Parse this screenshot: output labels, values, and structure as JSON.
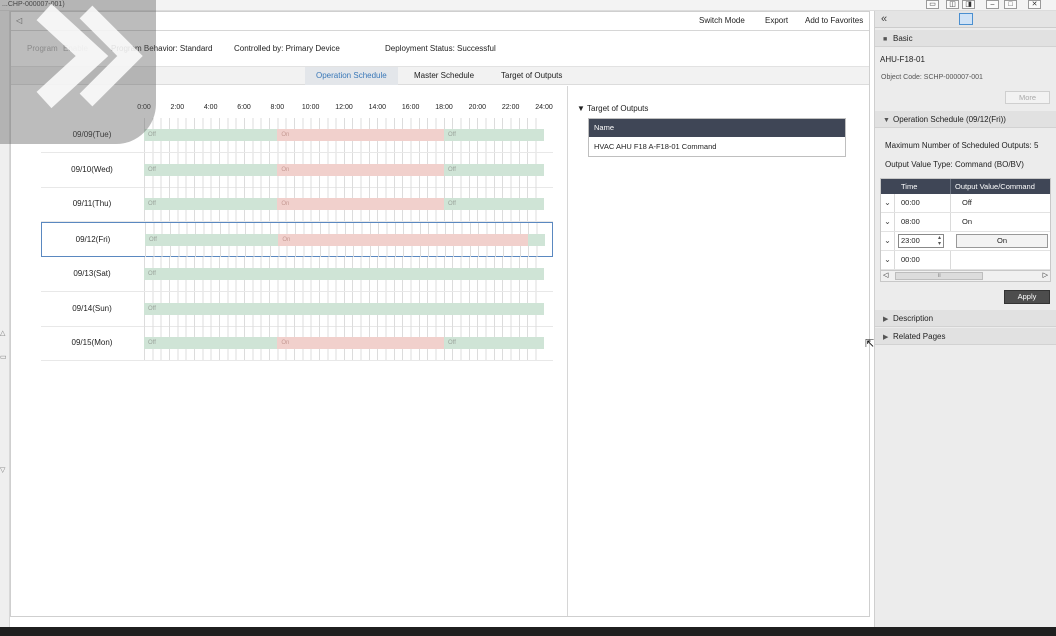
{
  "window": {
    "title": "...CHP-000007-001)"
  },
  "toolbar": {
    "switch_mode": "Switch Mode",
    "export": "Export",
    "add_to_favorites": "Add to Favorites"
  },
  "info": {
    "program_label": "Program",
    "enable_label": "Enable",
    "program_behavior": "Program Behavior: Standard",
    "controlled_by": "Controlled by: Primary Device",
    "deployment_status": "Deployment Status: Successful"
  },
  "tabs": [
    {
      "label": "Operation Schedule",
      "active": true
    },
    {
      "label": "Master Schedule",
      "active": false
    },
    {
      "label": "Target of Outputs",
      "active": false
    }
  ],
  "schedule": {
    "hours": [
      "0:00",
      "2:00",
      "4:00",
      "6:00",
      "8:00",
      "10:00",
      "12:00",
      "14:00",
      "16:00",
      "18:00",
      "20:00",
      "22:00",
      "24:00"
    ],
    "days": [
      {
        "label": "09/09(Tue)",
        "selected": false,
        "segments": [
          {
            "state": "off",
            "label": "Off",
            "start": 0,
            "end": 8
          },
          {
            "state": "on",
            "label": "On",
            "start": 8,
            "end": 18
          },
          {
            "state": "off",
            "label": "Off",
            "start": 18,
            "end": 24
          }
        ]
      },
      {
        "label": "09/10(Wed)",
        "selected": false,
        "segments": [
          {
            "state": "off",
            "label": "Off",
            "start": 0,
            "end": 8
          },
          {
            "state": "on",
            "label": "On",
            "start": 8,
            "end": 18
          },
          {
            "state": "off",
            "label": "Off",
            "start": 18,
            "end": 24
          }
        ]
      },
      {
        "label": "09/11(Thu)",
        "selected": false,
        "segments": [
          {
            "state": "off",
            "label": "Off",
            "start": 0,
            "end": 8
          },
          {
            "state": "on",
            "label": "On",
            "start": 8,
            "end": 18
          },
          {
            "state": "off",
            "label": "Off",
            "start": 18,
            "end": 24
          }
        ]
      },
      {
        "label": "09/12(Fri)",
        "selected": true,
        "segments": [
          {
            "state": "off",
            "label": "Off",
            "start": 0,
            "end": 8
          },
          {
            "state": "on",
            "label": "On",
            "start": 8,
            "end": 23
          },
          {
            "state": "off",
            "label": "",
            "start": 23,
            "end": 24
          }
        ]
      },
      {
        "label": "09/13(Sat)",
        "selected": false,
        "segments": [
          {
            "state": "off",
            "label": "Off",
            "start": 0,
            "end": 24
          }
        ]
      },
      {
        "label": "09/14(Sun)",
        "selected": false,
        "segments": [
          {
            "state": "off",
            "label": "Off",
            "start": 0,
            "end": 24
          }
        ]
      },
      {
        "label": "09/15(Mon)",
        "selected": false,
        "segments": [
          {
            "state": "off",
            "label": "Off",
            "start": 0,
            "end": 8
          },
          {
            "state": "on",
            "label": "On",
            "start": 8,
            "end": 18
          },
          {
            "state": "off",
            "label": "Off",
            "start": 18,
            "end": 24
          }
        ]
      }
    ]
  },
  "target": {
    "header": "Target of Outputs",
    "column": "Name",
    "rows": [
      "HVAC AHU F18 A-F18-01 Command"
    ]
  },
  "right_panel": {
    "basic_header": "Basic",
    "object_name": "AHU-F18-01",
    "object_code": "Object Code:  SCHP-000007-001",
    "more_label": "More",
    "op_header": "Operation Schedule (09/12(Fri))",
    "max_outputs": "Maximum Number of Scheduled Outputs: 5",
    "output_type": "Output Value Type:  Command (BO/BV)",
    "col_time": "Time",
    "col_value": "Output Value/Command",
    "rows": [
      {
        "time": "00:00",
        "value": "Off"
      },
      {
        "time": "08:00",
        "value": "On"
      },
      {
        "time": "23:00",
        "value": "On"
      },
      {
        "time": "00:00",
        "value": ""
      }
    ],
    "apply_label": "Apply",
    "description_header": "Description",
    "related_pages_header": "Related Pages"
  },
  "colors": {
    "off": "#cfe4d6",
    "on": "#f1d0cc",
    "table_header": "#3f4656",
    "active_tab": "#3a78b8"
  }
}
